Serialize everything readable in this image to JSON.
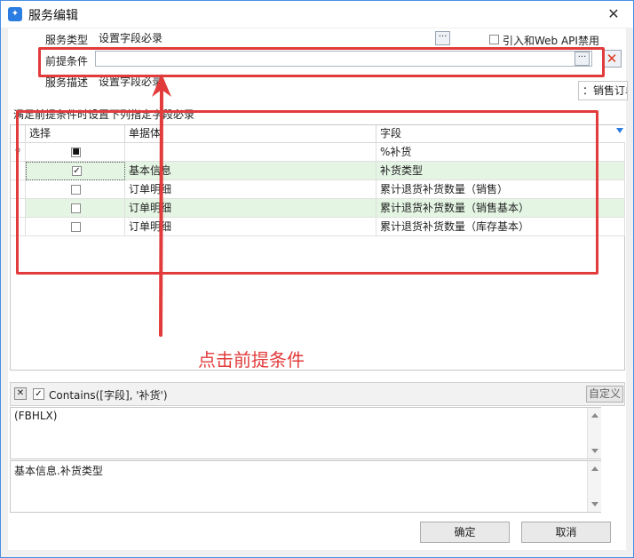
{
  "window": {
    "title": "服务编辑",
    "close_glyph": "✕"
  },
  "form": {
    "service_type_label": "服务类型",
    "service_type_value": "设置字段必录",
    "precondition_label": "前提条件",
    "precondition_value": "",
    "description_label": "服务描述",
    "description_value": "设置字段必录",
    "webapi_label": "引入和Web API禁用",
    "webapi_checked": false,
    "popup_text": "：销售订单",
    "ellipsis": "···"
  },
  "grid": {
    "caption": "满足前提条件时设置下列指定字段必录",
    "columns": [
      "选择",
      "单据体",
      "字段"
    ],
    "rows": [
      {
        "indicator": "♀",
        "select": "■",
        "entity": "",
        "field": "%补货",
        "highlight": false
      },
      {
        "indicator": "Ι",
        "select": "✓",
        "entity": "基本信息",
        "field": "补货类型",
        "highlight": true
      },
      {
        "indicator": "",
        "select": "",
        "entity": "订单明细",
        "field": "累计退货补货数量（销售）",
        "highlight": false
      },
      {
        "indicator": "",
        "select": "",
        "entity": "订单明细",
        "field": "累计退货补货数量（销售基本）",
        "highlight": true
      },
      {
        "indicator": "",
        "select": "",
        "entity": "订单明细",
        "field": "累计退货补货数量（库存基本）",
        "highlight": false
      }
    ]
  },
  "filter": {
    "clear_glyph": "✕",
    "checked": true,
    "expression": "Contains([字段], '补货')",
    "customize_label": "自定义"
  },
  "memo1": {
    "text": "(FBHLX)"
  },
  "memo2": {
    "text": "基本信息.补货类型"
  },
  "annotation": {
    "text": "点击前提条件",
    "color": "#e23b3b"
  },
  "buttons": {
    "ok": "确定",
    "cancel": "取消"
  }
}
